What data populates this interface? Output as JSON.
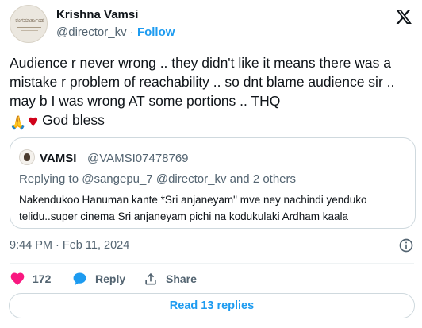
{
  "author": {
    "name": "Krishna Vamsi",
    "handle": "@director_kv",
    "separator": " · ",
    "follow_label": "Follow",
    "avatar_text": "ರಂಗಮಾರ್ತಾಂಡ"
  },
  "tweet": {
    "text": "Audience r never wrong .. they didn't like it means there was a mistake r problem of reachability .. so dnt blame audience sir .. may b I was wrong AT some portions .. THQ",
    "emoji_1": "🙏",
    "emoji_2": "♥",
    "text_end": " God bless"
  },
  "quote": {
    "name": "VAMSI",
    "handle": "@VAMSI07478769",
    "reply_prefix": "Replying to ",
    "reply_mentions": "@sangepu_7 @director_kv",
    "reply_suffix": " and 2 others",
    "body": "Nakendukoo Hanuman kante *Sri anjaneyam\" mve ney nachindi yenduko telidu..super cinema Sri anjaneyam pichi na kodukulaki  Ardham kaala"
  },
  "meta": {
    "time": "9:44 PM · Feb 11, 2024"
  },
  "actions": {
    "likes": "172",
    "reply_label": "Reply",
    "share_label": "Share"
  },
  "read_replies_label": "Read 13 replies",
  "colors": {
    "accent": "#1d9bf0",
    "like": "#f91880",
    "reply_icon": "#1d9bf0",
    "secondary_text": "#536471"
  }
}
